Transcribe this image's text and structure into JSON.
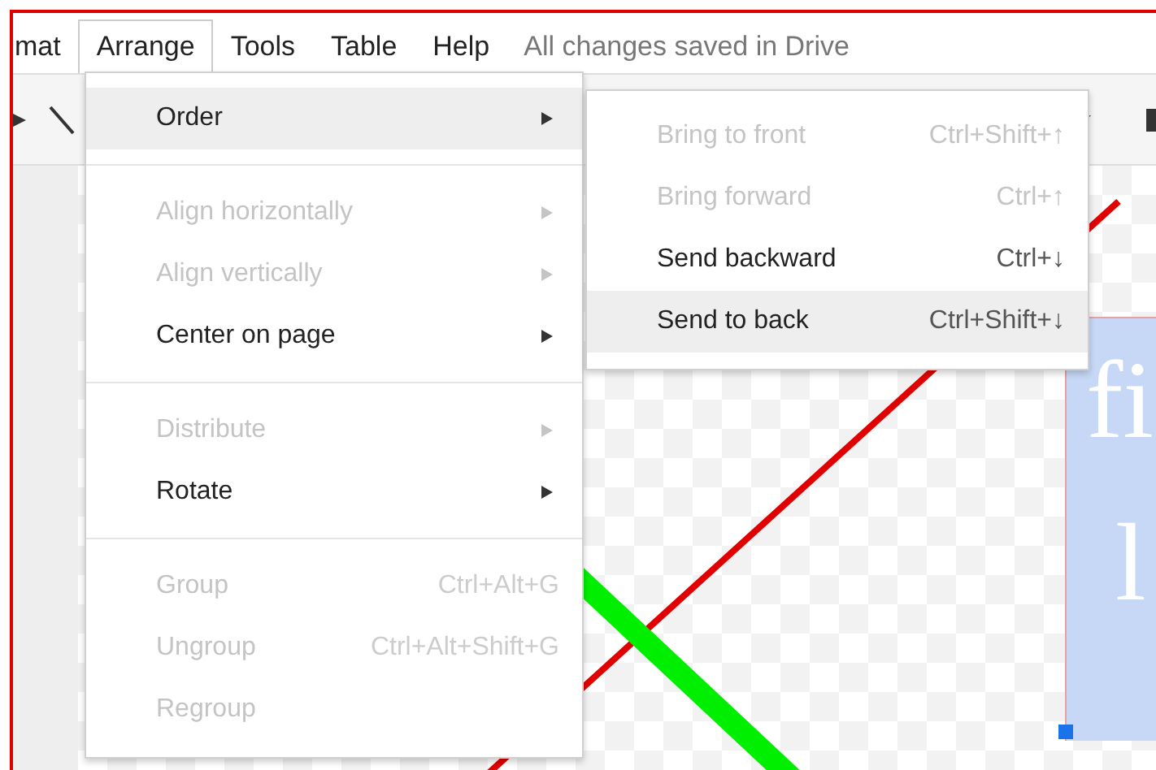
{
  "menu_bar": {
    "items": [
      {
        "label": "mat",
        "selected": false
      },
      {
        "label": "Arrange",
        "selected": true
      },
      {
        "label": "Tools",
        "selected": false
      },
      {
        "label": "Table",
        "selected": false
      },
      {
        "label": "Help",
        "selected": false
      }
    ],
    "status": "All changes saved in Drive"
  },
  "arrange_menu": {
    "sections": [
      [
        {
          "label": "Order",
          "disabled": false,
          "selected": true,
          "submenu": true
        }
      ],
      [
        {
          "label": "Align horizontally",
          "disabled": true,
          "selected": false,
          "submenu": true
        },
        {
          "label": "Align vertically",
          "disabled": true,
          "selected": false,
          "submenu": true
        },
        {
          "label": "Center on page",
          "disabled": false,
          "selected": false,
          "submenu": true
        }
      ],
      [
        {
          "label": "Distribute",
          "disabled": true,
          "selected": false,
          "submenu": true
        },
        {
          "label": "Rotate",
          "disabled": false,
          "selected": false,
          "submenu": true
        }
      ],
      [
        {
          "label": "Group",
          "shortcut": "Ctrl+Alt+G",
          "disabled": true,
          "selected": false,
          "submenu": false
        },
        {
          "label": "Ungroup",
          "shortcut": "Ctrl+Alt+Shift+G",
          "disabled": true,
          "selected": false,
          "submenu": false
        },
        {
          "label": "Regroup",
          "disabled": true,
          "selected": false,
          "submenu": false
        }
      ]
    ]
  },
  "order_submenu": {
    "items": [
      {
        "label": "Bring to front",
        "shortcut": "Ctrl+Shift+↑",
        "disabled": true,
        "selected": false
      },
      {
        "label": "Bring forward",
        "shortcut": "Ctrl+↑",
        "disabled": true,
        "selected": false
      },
      {
        "label": "Send backward",
        "shortcut": "Ctrl+↓",
        "disabled": false,
        "selected": false
      },
      {
        "label": "Send to back",
        "shortcut": "Ctrl+Shift+↓",
        "disabled": false,
        "selected": true
      }
    ]
  },
  "canvas": {
    "text_box": {
      "lines": [
        "fi",
        "l"
      ]
    }
  }
}
